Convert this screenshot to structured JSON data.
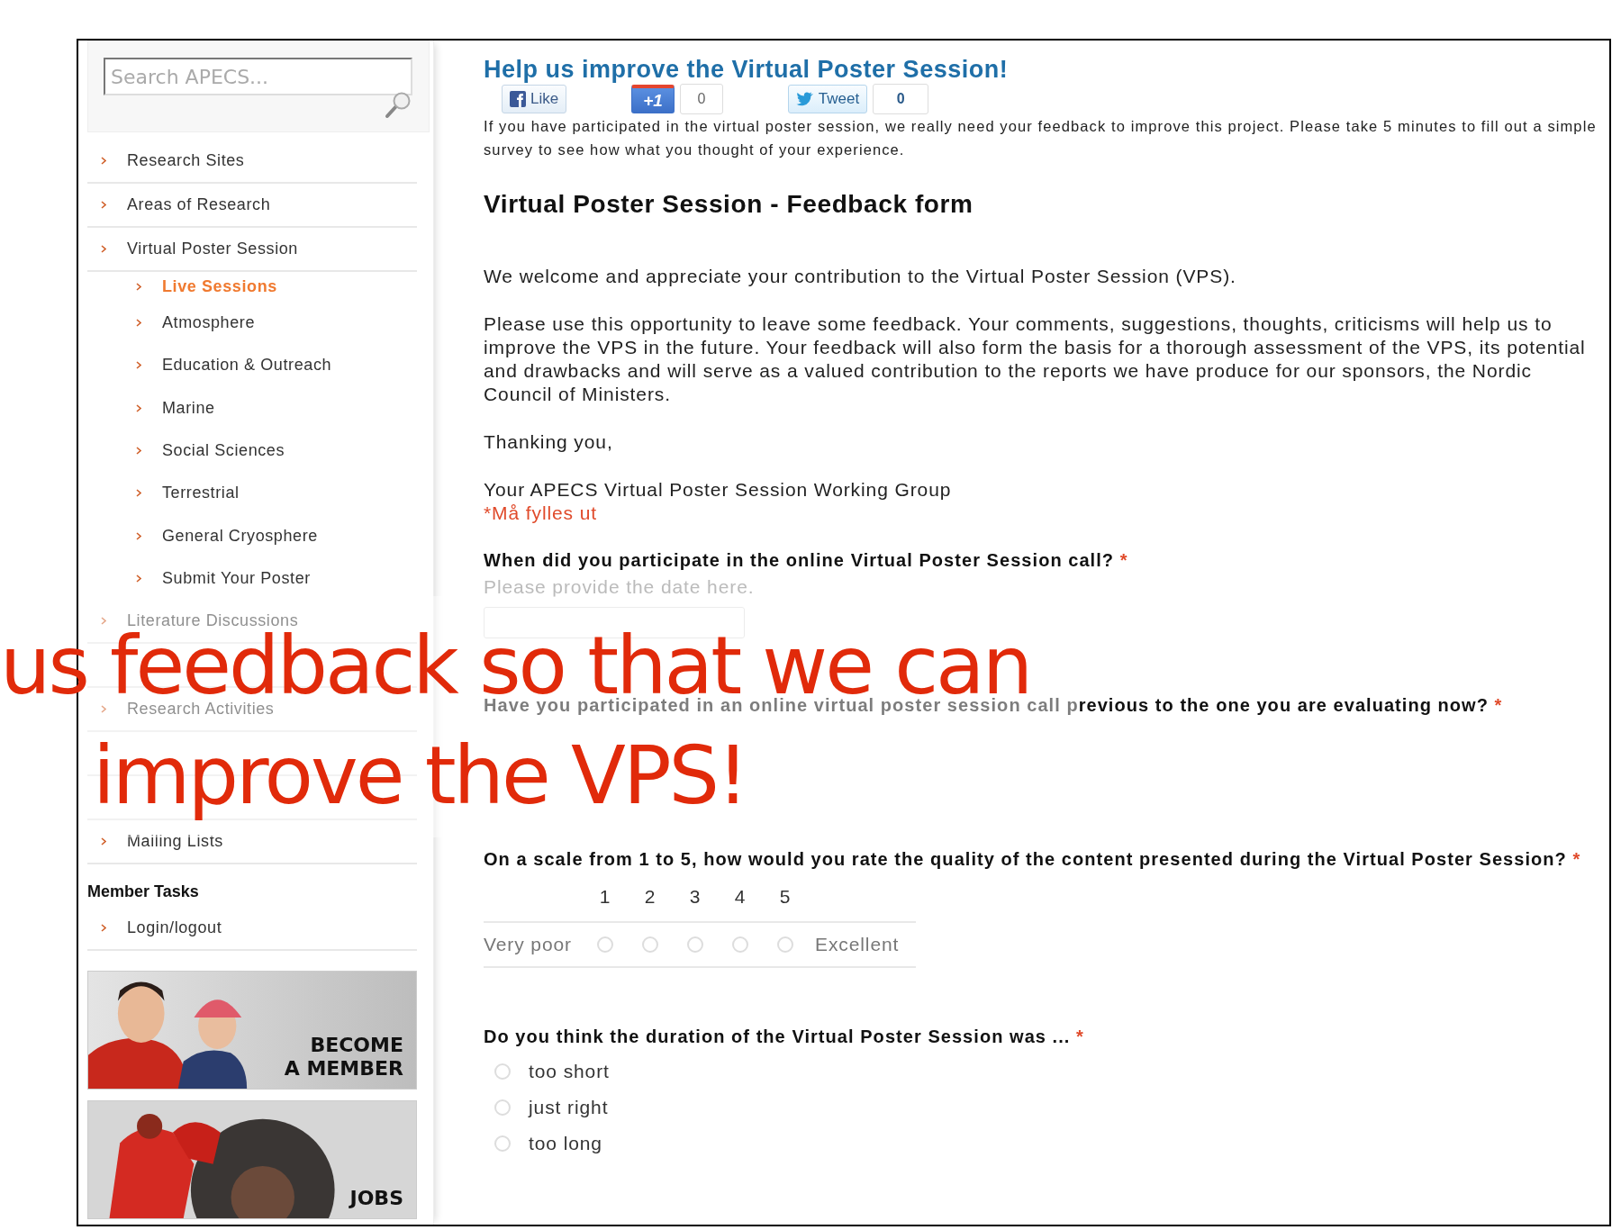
{
  "search": {
    "placeholder": "Search APECS..."
  },
  "nav": [
    {
      "label": "Research Sites",
      "selected": false
    },
    {
      "label": "Areas of Research",
      "selected": false
    },
    {
      "label": "Virtual Poster Session",
      "selected": false,
      "children": [
        {
          "label": "Live Sessions",
          "selected": true
        },
        {
          "label": "Atmosphere",
          "selected": false
        },
        {
          "label": "Education & Outreach",
          "selected": false
        },
        {
          "label": "Marine",
          "selected": false
        },
        {
          "label": "Social Sciences",
          "selected": false
        },
        {
          "label": "Terrestrial",
          "selected": false
        },
        {
          "label": "General Cryosphere",
          "selected": false
        },
        {
          "label": "Submit Your Poster",
          "selected": false
        }
      ]
    },
    {
      "label": "Literature Discussions",
      "selected": false
    },
    {
      "covered": true
    },
    {
      "label": "Research Activities",
      "selected": false
    },
    {
      "covered": true
    },
    {
      "covered": true
    },
    {
      "label": "Mailing Lists",
      "selected": false
    }
  ],
  "member_tasks": {
    "title": "Member Tasks",
    "items": [
      {
        "label": "Login/logout",
        "selected": false
      }
    ]
  },
  "banners": [
    {
      "kind": "members",
      "lines": [
        "BECOME",
        "A MEMBER"
      ]
    },
    {
      "kind": "jobs",
      "lines": [
        "JOBS"
      ]
    }
  ],
  "content": {
    "title": "Help us improve the Virtual Poster Session!",
    "social": [
      {
        "kind": "like",
        "label": "Like"
      },
      {
        "kind": "plusone",
        "label": "+1",
        "count": "0"
      },
      {
        "kind": "tweet",
        "label": "Tweet",
        "count": "0"
      }
    ],
    "intro": "If you have participated in the virtual poster session, we really need your feedback to improve this project.  Please take 5 minutes to fill out a simple survey to see how what you thought of your experience.",
    "form_title": "Virtual Poster Session - Feedback form",
    "paragraphs": [
      "We welcome and appreciate your contribution to the Virtual Poster Session (VPS).",
      "Please use this opportunity to leave some feedback.  Your comments, suggestions, thoughts, criticisms will help us to improve the VPS in the future.  Your feedback will also form the basis for a thorough assessment of the VPS, its potential and drawbacks and will serve as a valued contribution to the reports we have produce for our sponsors, the Nordic Council of Ministers.",
      "Thanking you,",
      "Your APECS Virtual Poster Session Working Group"
    ],
    "required_note": "*Må fylles ut",
    "questions": [
      {
        "kind": "text",
        "label": "When did you participate in the online Virtual Poster Session call?",
        "required_mark": "*",
        "hint": "Please provide the date here."
      },
      {
        "kind": "radio",
        "label": "Have you participated in an online virtual poster session call previous to the one you are evaluating now?",
        "required_mark": "*"
      },
      {
        "kind": "scale",
        "label": "On a scale from 1 to 5, how would you rate the quality of the content presented during the Virtual Poster Session?",
        "required_mark": "*",
        "numbers": [
          "1",
          "2",
          "3",
          "4",
          "5"
        ],
        "low": "Very poor",
        "high": "Excellent",
        "options": [
          {
            "selected": false
          },
          {
            "selected": false
          },
          {
            "selected": false
          },
          {
            "selected": false
          },
          {
            "selected": false
          }
        ]
      },
      {
        "kind": "radio",
        "label": "Do you think the duration of the Virtual Poster Session was ...",
        "required_mark": "*",
        "options": [
          {
            "label": "too short",
            "selected": false
          },
          {
            "label": "just right",
            "selected": false
          },
          {
            "label": "too long",
            "selected": false
          }
        ]
      }
    ]
  },
  "overlay": {
    "lines": [
      "us feedback so that we can",
      "improve the VPS!"
    ]
  }
}
